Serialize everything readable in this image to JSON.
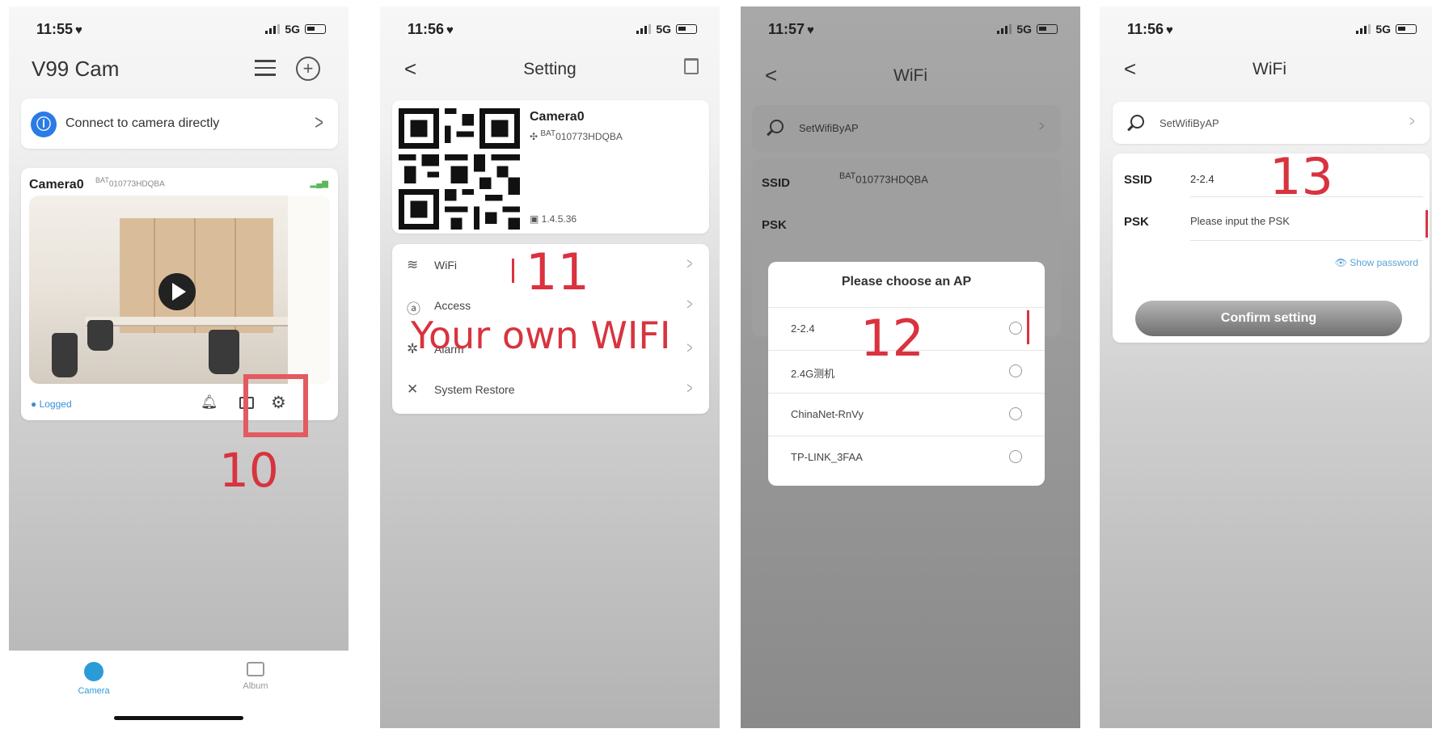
{
  "phones": {
    "p1": {
      "time": "11:55",
      "network": "5G",
      "app_title": "V99 Cam",
      "connect_label": "Connect to camera directly",
      "camera_name": "Camera0",
      "camera_id_sup": "BAT",
      "camera_id": "010773HDQBA",
      "logged": "● Logged",
      "step_note": "10",
      "tabs": [
        {
          "label": "Camera",
          "active": true
        },
        {
          "label": "Album",
          "active": false
        }
      ]
    },
    "p2": {
      "time": "11:56",
      "network": "5G",
      "title": "Setting",
      "camera_name": "Camera0",
      "camera_id_sup": "BAT",
      "camera_id": "010773HDQBA",
      "version": "1.4.5.36",
      "menu": [
        {
          "label": "WiFi",
          "icon": "wifi-icon"
        },
        {
          "label": "Access",
          "icon": "person-icon"
        },
        {
          "label": "Alarm",
          "icon": "alarm-icon"
        },
        {
          "label": "System Restore",
          "icon": "restore-icon"
        }
      ],
      "step_note": "11",
      "wifi_note": "Your own WIFI"
    },
    "p3": {
      "time": "11:57",
      "network": "5G",
      "title": "WiFi",
      "setwifi_label": "SetWifiByAP",
      "ssid_label": "SSID",
      "ssid_sup": "BAT",
      "ssid_value": "010773HDQBA",
      "psk_label": "PSK",
      "dialog_title": "Please choose an AP",
      "aps": [
        "2-2.4",
        "2.4G测机",
        "ChinaNet-RnVy",
        "TP-LINK_3FAA"
      ],
      "step_note": "12"
    },
    "p4": {
      "time": "11:56",
      "network": "5G",
      "title": "WiFi",
      "setwifi_label": "SetWifiByAP",
      "ssid_label": "SSID",
      "ssid_value": "2-2.4",
      "psk_label": "PSK",
      "psk_placeholder": "Please input the PSK",
      "show_password": "Show password",
      "confirm_label": "Confirm setting",
      "step_note": "13"
    }
  },
  "colors": {
    "annotation_red": "#d8333f",
    "accent_blue": "#2b7be5"
  }
}
